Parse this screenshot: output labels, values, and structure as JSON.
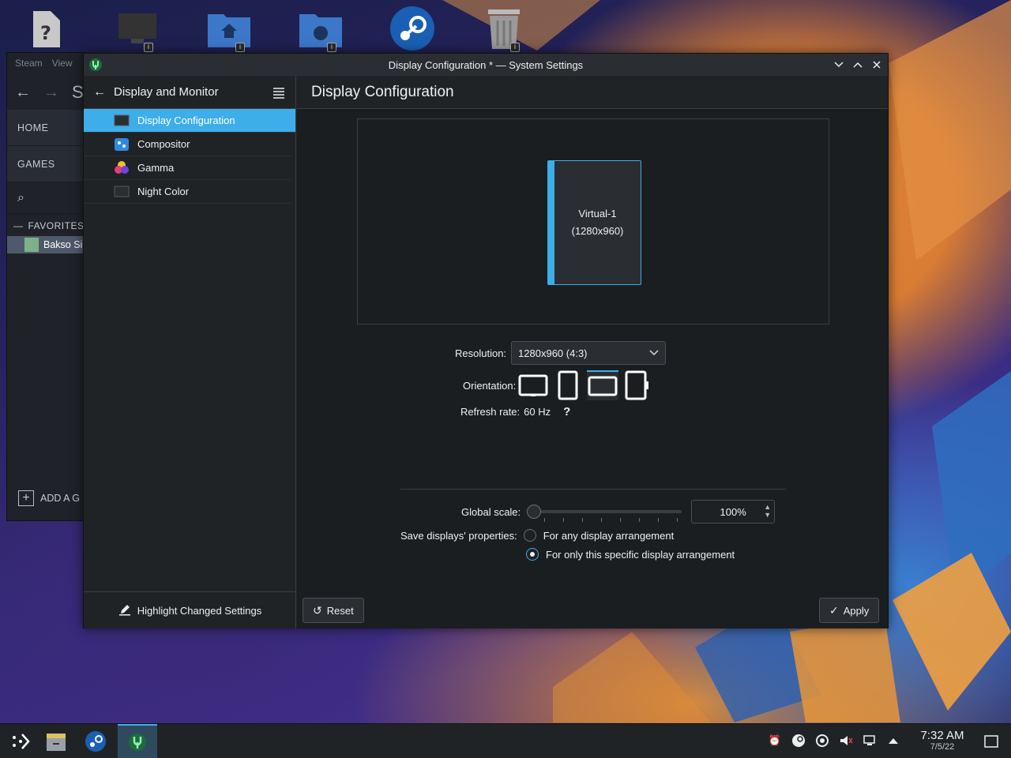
{
  "desktop": {
    "icons": [
      "unknown-file-icon",
      "monitor-icon",
      "home-folder-icon",
      "network-folder-icon",
      "steam-icon",
      "trash-icon"
    ]
  },
  "steam_bg": {
    "menu": [
      "Steam",
      "View"
    ],
    "title_fragment": "ST",
    "home": "HOME",
    "games": "GAMES",
    "favorites": "FAVORITES",
    "game": "Bakso Si",
    "add_game": "ADD A G"
  },
  "window": {
    "title": "Display Configuration * — System Settings"
  },
  "sidebar": {
    "header": "Display and Monitor",
    "items": [
      {
        "label": "Display Configuration"
      },
      {
        "label": "Compositor"
      },
      {
        "label": "Gamma"
      },
      {
        "label": "Night Color"
      }
    ],
    "footer": "Highlight Changed Settings"
  },
  "main": {
    "title": "Display Configuration",
    "monitor_name": "Virtual-1",
    "monitor_res": "(1280x960)",
    "resolution_label": "Resolution:",
    "resolution_value": "1280x960 (4:3)",
    "orientation_label": "Orientation:",
    "refresh_label": "Refresh rate:",
    "refresh_value": "60 Hz",
    "refresh_help": "?",
    "scale_label": "Global scale:",
    "scale_value": "100%",
    "scale_level": 0.0,
    "save_label": "Save displays' properties:",
    "save_options": [
      {
        "label": "For any display arrangement",
        "selected": false
      },
      {
        "label": "For only this specific display arrangement",
        "selected": true
      }
    ],
    "reset": "Reset",
    "apply": "Apply"
  },
  "taskbar": {
    "time": "7:32 AM",
    "date": "7/5/22"
  },
  "colors": {
    "accent": "#3daee9",
    "window_bg": "#202326"
  }
}
